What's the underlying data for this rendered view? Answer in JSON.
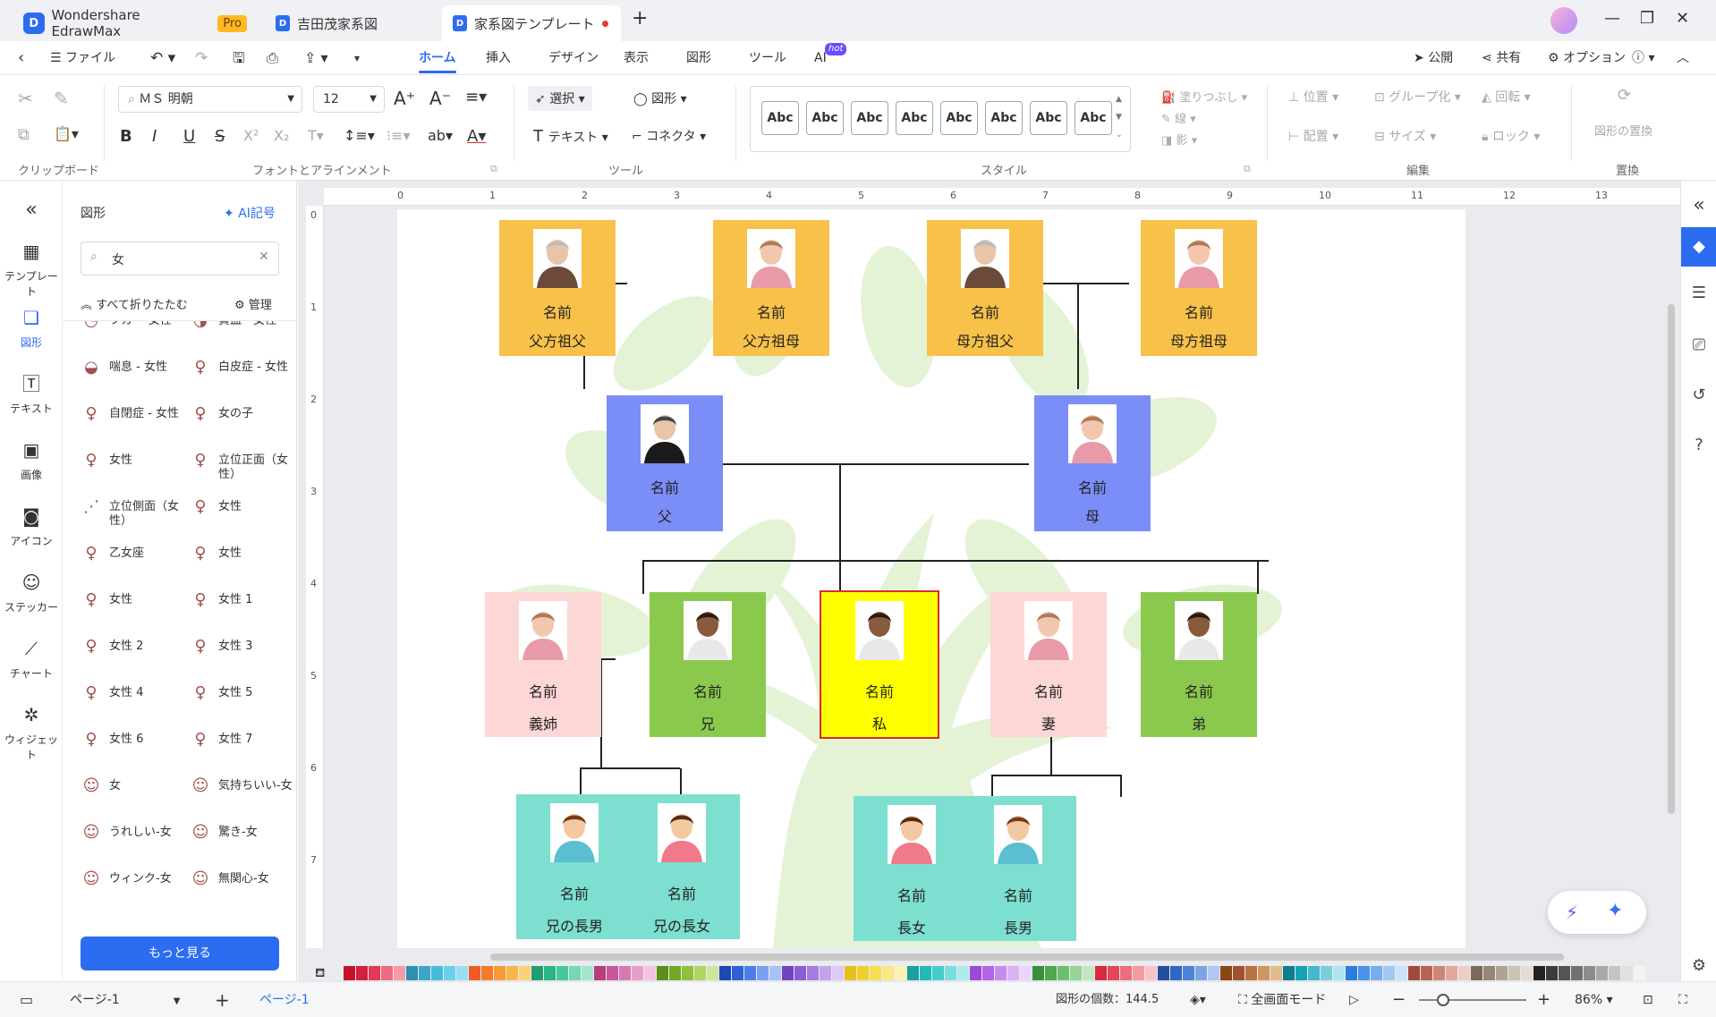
{
  "tabs": [
    {
      "label": "Wondershare EdrawMax",
      "badge": "Pro"
    },
    {
      "label": "吉田茂家系図"
    },
    {
      "label": "家系図テンプレート",
      "modified": true
    }
  ],
  "menu": {
    "file": "ファイル",
    "items": [
      "ホーム",
      "挿入",
      "デザイン",
      "表示",
      "図形",
      "ツール",
      "AI"
    ],
    "ai_badge": "hot",
    "right": [
      "公開",
      "共有",
      "オプション"
    ]
  },
  "ribbon": {
    "groups": {
      "clipboard": "クリップボード",
      "font": "フォントとアラインメント",
      "tools": "ツール",
      "style": "スタイル",
      "edit": "編集",
      "replace": "置換"
    },
    "font_name": "ＭＳ 明朝",
    "font_size": "12",
    "select": "選択",
    "shape": "図形",
    "text": "テキスト",
    "connector": "コネクタ",
    "style_sample": "Abc",
    "fill": "塗りつぶし",
    "line": "線",
    "shadow": "影",
    "position": "位置",
    "group": "グループ化",
    "rotate": "回転",
    "align": "配置",
    "size": "サイズ",
    "lock": "ロック",
    "replace_shape": "図形の置換"
  },
  "leftnav": [
    "テンプレート",
    "図形",
    "テキスト",
    "画像",
    "アイコン",
    "ステッカー",
    "チャート",
    "ウィジェット"
  ],
  "panel": {
    "title": "図形",
    "ai_symbol": "AI記号",
    "search_value": "女",
    "collapse_all": "すべて折りたたむ",
    "manage": "管理",
    "more": "もっと見る",
    "shapes": [
      "ツカ-・女性",
      "貧血 - 女性",
      "喘息 - 女性",
      "白皮症 - 女性",
      "自閉症 - 女性",
      "女の子",
      "女性",
      "立位正面（女性）",
      "立位側面（女性）",
      "女性",
      "乙女座",
      "女性",
      "女性",
      "女性 1",
      "女性 2",
      "女性 3",
      "女性 4",
      "女性 5",
      "女性 6",
      "女性 7",
      "女",
      "気持ちいい-女",
      "うれしい-女",
      "驚き-女",
      "ウィンク-女",
      "無関心-女"
    ]
  },
  "ruler": {
    "h": [
      "0",
      "1",
      "2",
      "3",
      "4",
      "5",
      "6",
      "7",
      "8",
      "9",
      "10",
      "11",
      "12",
      "13"
    ],
    "v": [
      "0",
      "1",
      "2",
      "3",
      "4",
      "5",
      "6",
      "7"
    ]
  },
  "tree": {
    "name": "名前",
    "nodes": [
      {
        "role": "父方祖父",
        "color": "#f8c14a",
        "person": "elder-man"
      },
      {
        "role": "父方祖母",
        "color": "#f8c14a",
        "person": "woman"
      },
      {
        "role": "母方祖父",
        "color": "#f8c14a",
        "person": "elder-man"
      },
      {
        "role": "母方祖母",
        "color": "#f8c14a",
        "person": "woman"
      },
      {
        "role": "父",
        "color": "#7b8ef7",
        "person": "man-suit"
      },
      {
        "role": "母",
        "color": "#7b8ef7",
        "person": "woman"
      },
      {
        "role": "義姉",
        "color": "#fdd6d6",
        "person": "woman"
      },
      {
        "role": "兄",
        "color": "#8bc94e",
        "person": "man"
      },
      {
        "role": "私",
        "color": "#ffff00",
        "person": "man",
        "selected": true
      },
      {
        "role": "妻",
        "color": "#fdd6d6",
        "person": "woman"
      },
      {
        "role": "弟",
        "color": "#8bc94e",
        "person": "man"
      },
      {
        "role": "兄の長男",
        "color": "#7ddfd0",
        "person": "boy"
      },
      {
        "role": "兄の長女",
        "color": "#7ddfd0",
        "person": "girl"
      },
      {
        "role": "長女",
        "color": "#7ddfd0",
        "person": "girl"
      },
      {
        "role": "長男",
        "color": "#7ddfd0",
        "person": "boy"
      }
    ]
  },
  "status": {
    "page_select": "ページ-1",
    "page_tab": "ページ-1",
    "shape_count_label": "図形の個数：",
    "shape_count": "144.5",
    "fullscreen": "全画面モード",
    "zoom": "86%"
  },
  "colors": {
    "accent": "#2b6cf0",
    "palette": [
      "#c8102e",
      "#d0213f",
      "#e23a55",
      "#ef6b82",
      "#f49aa8",
      "#2f8fb0",
      "#3aa7c9",
      "#46bcd9",
      "#6dd0ea",
      "#98e0f1",
      "#f05a28",
      "#f47b2a",
      "#f89a36",
      "#fbb54e",
      "#fdd07a",
      "#1f9e6e",
      "#2bb585",
      "#48c89a",
      "#74d8b2",
      "#a4e6cc",
      "#b83d7c",
      "#c9559a",
      "#d977b1",
      "#e89ecb",
      "#f3c4e0",
      "#5a8f1d",
      "#74a824",
      "#92c03a",
      "#b0d564",
      "#cde798",
      "#2047b5",
      "#2e62d4",
      "#4b7fe6",
      "#7aa1ef",
      "#a9c2f5",
      "#7043c0",
      "#8a5cd6",
      "#a57de2",
      "#c2a3ed",
      "#dccaf5",
      "#e8c01b",
      "#f1d02e",
      "#f7de55",
      "#fae984",
      "#fcf2b4",
      "#1aa0a0",
      "#22b9b9",
      "#45cccc",
      "#7bdddd",
      "#aeeaea",
      "#9b4ad8",
      "#b066e6",
      "#c58cee",
      "#d9b3f5",
      "#ebd6fa",
      "#3a8f3a",
      "#4ea84e",
      "#6fbe6f",
      "#98d398",
      "#c2e6c2",
      "#d8293e",
      "#e34859",
      "#ec6e7b",
      "#f39aa3",
      "#f8c3c8",
      "#244f9e",
      "#2f66c2",
      "#4e82d6",
      "#7ea5e3",
      "#aec8ef",
      "#8b4513",
      "#a0522d",
      "#b8733f",
      "#cf9760",
      "#e2bb8a",
      "#0f7b8f",
      "#17a2b8",
      "#43b8cb",
      "#7bcfdc",
      "#b0e4ec",
      "#2a7de1",
      "#4a94e8",
      "#74afee",
      "#a0c9f4",
      "#cbe2f9",
      "#a04a3c",
      "#b86454",
      "#cc8577",
      "#dfa99e",
      "#eecdc6",
      "#7a6a5a",
      "#958676",
      "#b0a394",
      "#cbc1b4",
      "#e4ddd4",
      "#222222",
      "#3b3b3b",
      "#555555",
      "#707070",
      "#8c8c8c",
      "#a8a8a8",
      "#c4c4c4",
      "#e0e0e0",
      "#f2f2f2"
    ]
  }
}
